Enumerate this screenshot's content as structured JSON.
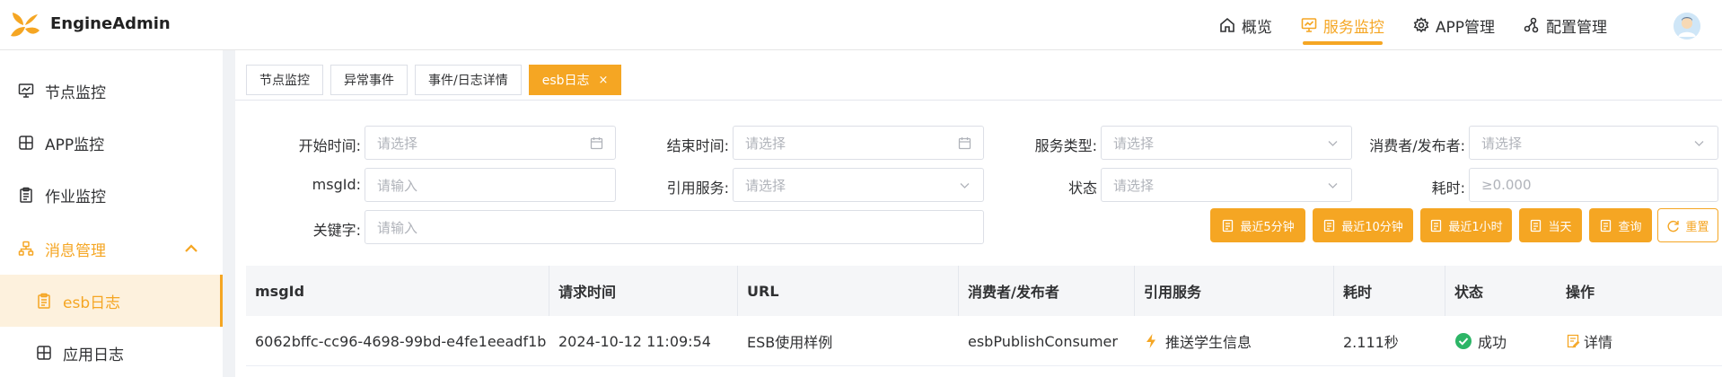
{
  "app": {
    "brand": "EngineAdmin",
    "primary_color": "#f5a623"
  },
  "topnav": [
    {
      "label": "概览",
      "icon": "home-icon"
    },
    {
      "label": "服务监控",
      "icon": "monitor-icon",
      "active": true
    },
    {
      "label": "APP管理",
      "icon": "gear-icon"
    },
    {
      "label": "配置管理",
      "icon": "cluster-icon"
    }
  ],
  "sidebar": {
    "items": [
      {
        "label": "节点监控",
        "icon": "monitor-icon"
      },
      {
        "label": "APP监控",
        "icon": "grid-icon"
      },
      {
        "label": "作业监控",
        "icon": "clipboard-icon"
      },
      {
        "label": "消息管理",
        "icon": "message-icon",
        "expanded": true
      },
      {
        "label": "esb日志",
        "icon": "document-icon",
        "selected": true
      },
      {
        "label": "应用日志",
        "icon": "grid-icon"
      }
    ]
  },
  "tabs": [
    {
      "label": "节点监控"
    },
    {
      "label": "异常事件"
    },
    {
      "label": "事件/日志详情"
    },
    {
      "label": "esb日志",
      "active": true,
      "close": "×"
    }
  ],
  "filters": {
    "start_time": {
      "label": "开始时间:",
      "placeholder": "请选择"
    },
    "end_time": {
      "label": "结束时间:",
      "placeholder": "请选择"
    },
    "service_type": {
      "label": "服务类型:",
      "placeholder": "请选择"
    },
    "consumer": {
      "label": "消费者/发布者:",
      "placeholder": "请选择"
    },
    "msgid": {
      "label": "msgId:",
      "placeholder": "请输入"
    },
    "ref_service": {
      "label": "引用服务:",
      "placeholder": "请选择"
    },
    "status": {
      "label": "状态",
      "placeholder": "请选择"
    },
    "duration": {
      "label": "耗时:",
      "placeholder": "≥0.000"
    },
    "keyword": {
      "label": "关键字:",
      "placeholder": "请输入"
    }
  },
  "buttons": {
    "last5": "最近5分钟",
    "last10": "最近10分钟",
    "last1h": "最近1小时",
    "today": "当天",
    "query": "查询",
    "reset": "重置"
  },
  "table": {
    "columns": [
      "msgId",
      "请求时间",
      "URL",
      "消费者/发布者",
      "引用服务",
      "耗时",
      "状态",
      "操作"
    ],
    "rows": [
      {
        "msgid": "6062bffc-cc96-4698-99bd-e4fe1eeadf1b",
        "time": "2024-10-12 11:09:54",
        "url": "ESB使用样例",
        "consumer": "esbPublishConsumer",
        "service": "推送学生信息",
        "duration": "2.111秒",
        "status": "成功",
        "action": "详情"
      }
    ]
  }
}
